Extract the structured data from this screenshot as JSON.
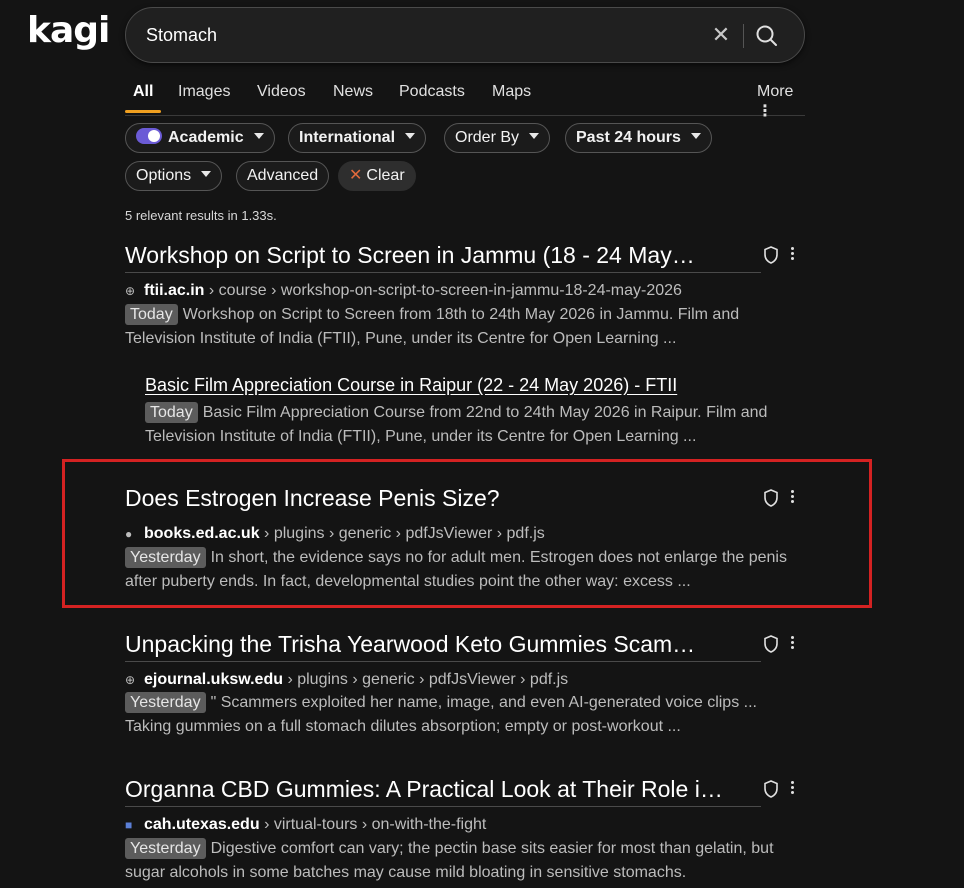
{
  "app": {
    "logo": "kagi"
  },
  "search": {
    "query": "Stomach"
  },
  "tabs": [
    {
      "label": "All"
    },
    {
      "label": "Images"
    },
    {
      "label": "Videos"
    },
    {
      "label": "News"
    },
    {
      "label": "Podcasts"
    },
    {
      "label": "Maps"
    },
    {
      "label": "More"
    }
  ],
  "filters": {
    "academic": "Academic",
    "region": "International",
    "order": "Order By",
    "time": "Past 24 hours",
    "options": "Options",
    "advanced": "Advanced",
    "clear": "Clear"
  },
  "summary": "5 relevant results in 1.33s.",
  "results": [
    {
      "title": "Workshop on Script to Screen in Jammu (18 - 24 May…",
      "domain": "ftii.ac.in",
      "path": "› course › workshop-on-script-to-screen-in-jammu-18-24-may-2026",
      "badge": "Today",
      "snippet": "Workshop on Script to Screen from 18th to 24th May 2026 in Jammu. Film and Television Institute of India (FTII), Pune, under its Centre for Open Learning ...",
      "sub": {
        "title": "Basic Film Appreciation Course in Raipur (22 - 24 May 2026) - FTII",
        "badge": "Today",
        "snippet": "Basic Film Appreciation Course from 22nd to 24th May 2026 in Raipur. Film and Television Institute of India (FTII), Pune, under its Centre for Open Learning ..."
      }
    },
    {
      "title": "Does Estrogen Increase Penis Size?",
      "domain": "books.ed.ac.uk",
      "path": "› plugins › generic › pdfJsViewer › pdf.js",
      "badge": "Yesterday",
      "snippet": "In short, the evidence says no for adult men. Estrogen does not enlarge the penis after puberty ends. In fact, developmental studies point the other way: excess ..."
    },
    {
      "title": "Unpacking the Trisha Yearwood Keto Gummies Scam…",
      "domain": "ejournal.uksw.edu",
      "path": "› plugins › generic › pdfJsViewer › pdf.js",
      "badge": "Yesterday",
      "snippet": "\" Scammers exploited her name, image, and even AI-generated voice clips ... Taking gummies on a full stomach dilutes absorption; empty or post-workout ..."
    },
    {
      "title": "Organna CBD Gummies: A Practical Look at Their Role i…",
      "domain": "cah.utexas.edu",
      "path": "› virtual-tours › on-with-the-fight",
      "badge": "Yesterday",
      "snippet": "Digestive comfort can vary; the pectin base sits easier for most than gelatin, but sugar alcohols in some batches may cause mild bloating in sensitive stomachs."
    }
  ],
  "colors": {
    "accent": "#f0a020",
    "toggle": "#6b5bd6",
    "highlight": "#d42222",
    "clear_icon": "#e26a3c"
  }
}
